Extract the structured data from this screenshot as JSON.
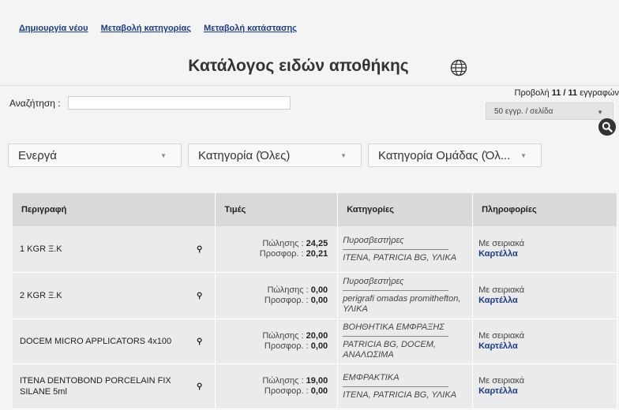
{
  "nav": {
    "create_new": "Δημιουργία νέου",
    "change_category": "Μεταβολή κατηγορίας",
    "change_status": "Μεταβολή κατάστασης"
  },
  "page": {
    "title": "Κατάλογος ειδών αποθήκης",
    "globe_icon": "globe-icon"
  },
  "search": {
    "label": "Αναζήτηση :",
    "value": "",
    "placeholder": ""
  },
  "view": {
    "prefix": "Προβολή",
    "shown": "11",
    "sep": " / ",
    "total": "11",
    "suffix": "εγγραφών"
  },
  "perpage": {
    "selected": "50 εγγρ. / σελίδα"
  },
  "filters": {
    "status": "Ενεργά",
    "category": "Κατηγορία (Όλες)",
    "group_category": "Κατηγορία Ομάδας (Όλ..."
  },
  "table": {
    "headers": [
      "Περιγραφή",
      "Τιμές",
      "Κατηγορίες",
      "Πληροφορίες"
    ],
    "rows": [
      {
        "desc": "1 KGR Ξ.Κ",
        "sale_label": "Πώλησης :",
        "sale": "24,25",
        "offer_label": "Προσφορ. :",
        "offer": "20,21",
        "cat_top": "Πυροσβεστήρες",
        "cat_bottom": "ITENA, PATRICIA BG, ΥΛΙΚΑ",
        "info": "Με σειριακά",
        "card": "Καρτέλλα"
      },
      {
        "desc": "2 KGR Ξ.Κ",
        "sale_label": "Πώλησης :",
        "sale": "0,00",
        "offer_label": "Προσφορ. :",
        "offer": "0,00",
        "cat_top": "Πυροσβεστήρες",
        "cat_bottom": "perigrafi omadas promithefton, ΥΛΙΚΑ",
        "info": "Με σειριακά",
        "card": "Καρτέλλα"
      },
      {
        "desc": "DOCEM MICRO APPLICATORS 4x100",
        "sale_label": "Πώλησης :",
        "sale": "20,00",
        "offer_label": "Προσφορ. :",
        "offer": "0,00",
        "cat_top": "ΒΟΗΘΗΤΙΚΑ ΕΜΦΡΑΞΗΣ",
        "cat_bottom": "PATRICIA BG, DOCEM, ΑΝΑΛΩΣΙΜΑ",
        "info": "Με σειριακά",
        "card": "Καρτέλλα"
      },
      {
        "desc": "ITENA DENTOBOND PORCELAIN FIX SILANE 5ml",
        "sale_label": "Πώλησης :",
        "sale": "19,00",
        "offer_label": "Προσφορ. :",
        "offer": "0,00",
        "cat_top": "ΕΜΦΡΑΚΤΙΚΑ",
        "cat_bottom": "ITENA, PATRICIA BG, ΥΛΙΚΑ",
        "info": "Με σειριακά",
        "card": "Καρτέλλα"
      }
    ]
  }
}
